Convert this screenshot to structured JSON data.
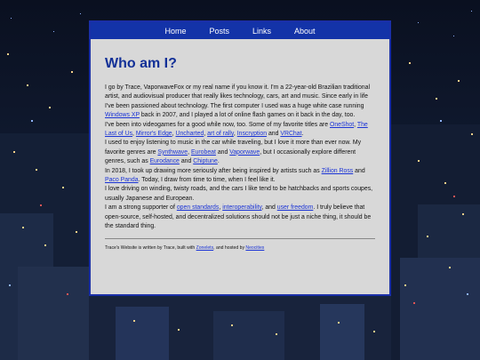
{
  "nav": {
    "items": [
      {
        "label": "Home"
      },
      {
        "label": "Posts"
      },
      {
        "label": "Links"
      },
      {
        "label": "About"
      }
    ]
  },
  "main": {
    "title": "Who am I?",
    "p1": {
      "t1": "I go by Trace, VaporwaveFox or my real name if you know it. I'm a 22-year-old Brazilian traditional artist, and audiovisual producer that really likes technology, cars, art and music. Since early in life I've been passioned about technology. The first computer I used was a huge white case running ",
      "l1": "Windows XP",
      "t2": " back in 2007, and I played a lot of online flash games on it back in the day, too."
    },
    "p2": {
      "t1": "I've been into videogames for a good while now, too. Some of my favorite titles are ",
      "l1": "OneShot",
      "s1": ", ",
      "l2": "The Last of Us",
      "s2": ", ",
      "l3": "Mirror's Edge",
      "s3": ", ",
      "l4": "Uncharted",
      "s4": ", ",
      "l5": "art of rally",
      "s5": ", ",
      "l6": "Inscryption",
      "s6": " and ",
      "l7": "VRChat",
      "s7": "."
    },
    "p3": {
      "t1": "I used to enjoy listening to music in the car while traveling, but I love it more than ever now. My favorite genres are ",
      "l1": "Synthwave",
      "s1": ", ",
      "l2": "Eurobeat",
      "s2": " and ",
      "l3": "Vaporwave",
      "s3": ", but I occasionally explore different genres, such as ",
      "l4": "Eurodance",
      "s4": " and ",
      "l5": "Chiptune",
      "s5": "."
    },
    "p4": {
      "t1": "In 2018, I took up drawing more seriously after being inspired by artists such as ",
      "l1": "Zillion Ross",
      "s1": " and ",
      "l2": "Paco Panda",
      "s2": ". Today, I draw from time to time, when I feel like it."
    },
    "p5": {
      "t1": "I love driving on winding, twisty roads, and the cars I like tend to be hatchbacks and sports coupes, usually Japanese and European."
    },
    "p6": {
      "t1": "I am a strong supporter of ",
      "l1": "open standards",
      "s1": ", ",
      "l2": "interoperability",
      "s2": ", and ",
      "l3": "user freedom",
      "s3": ". I truly believe that open-source, self-hosted, and decentralized solutions should not be just a niche thing, it should be the standard thing."
    }
  },
  "footer": {
    "t1": "Trace's Website is written by Trace, built with ",
    "l1": "Zonelets",
    "s1": ", and hosted by ",
    "l2": "Neocities"
  },
  "colors": {
    "nav_bg": "#1333a8",
    "title": "#123097",
    "link": "#1b34d6",
    "card_bg": "#d8d8d8"
  }
}
